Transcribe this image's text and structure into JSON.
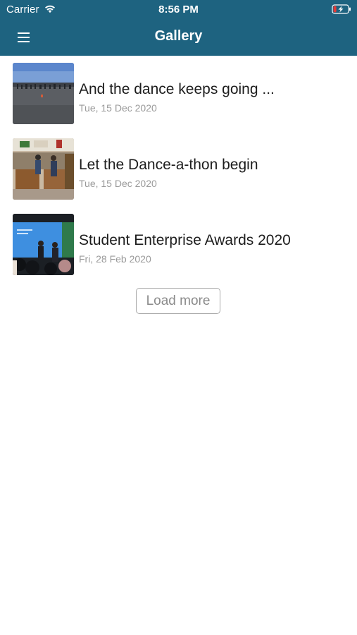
{
  "status_bar": {
    "carrier": "Carrier",
    "time": "8:56 PM",
    "wifi_icon": "wifi-icon",
    "battery_icon": "battery-charging-icon"
  },
  "nav": {
    "menu_icon": "hamburger-menu-icon",
    "title": "Gallery"
  },
  "gallery": {
    "items": [
      {
        "title": "And the dance keeps going ...",
        "date": "Tue, 15 Dec 2020",
        "thumbnail": "outdoor-playground-photo"
      },
      {
        "title": "Let the Dance-a-thon begin",
        "date": "Tue, 15 Dec 2020",
        "thumbnail": "school-hall-photo"
      },
      {
        "title": "Student Enterprise Awards 2020",
        "date": "Fri, 28 Feb 2020",
        "thumbnail": "awards-stage-photo"
      }
    ],
    "load_more_label": "Load more"
  },
  "colors": {
    "header_background": "#1e6380",
    "header_text": "#ffffff",
    "date_text": "#9a9a9a",
    "button_border": "#a8a8a8"
  }
}
